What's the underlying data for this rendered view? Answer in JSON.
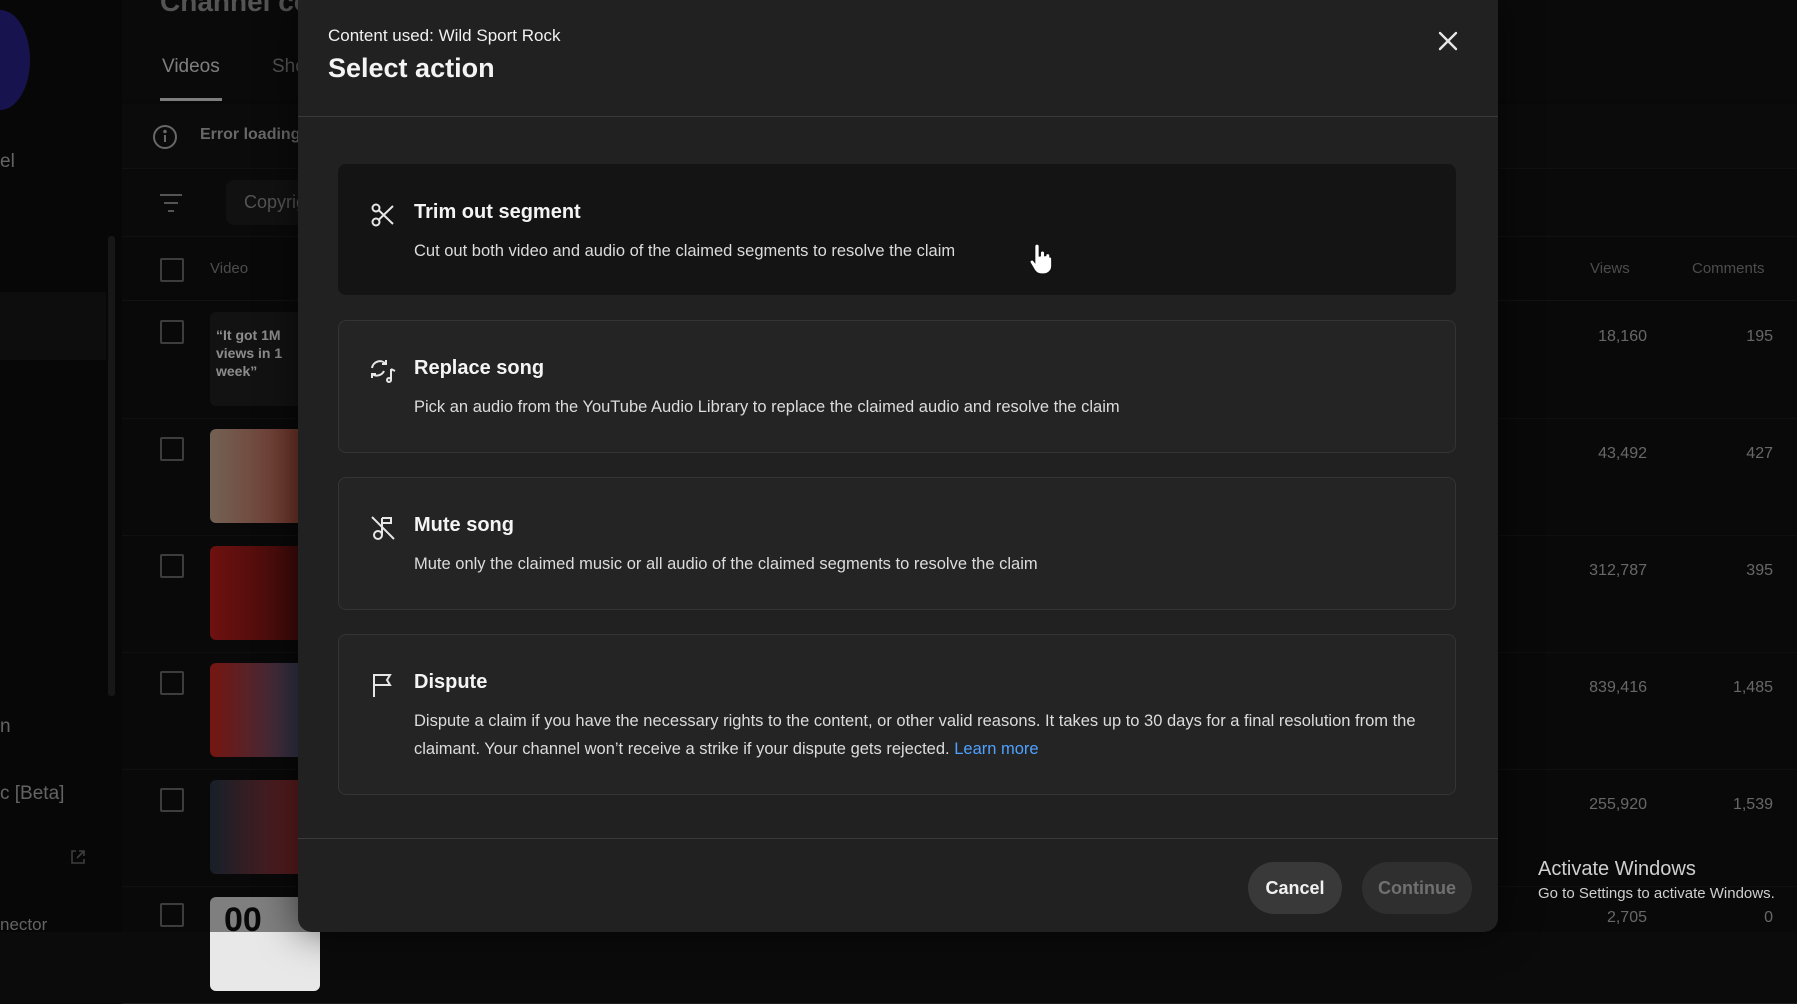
{
  "background": {
    "rail": {
      "texts": [
        "el",
        "n",
        "c [Beta]",
        "nector"
      ]
    },
    "tabs": [
      "Videos",
      "Sho"
    ],
    "header_partial": "Channel co",
    "error_text": "Error loading",
    "filter_chip": "Copyrig",
    "columns": {
      "video": "Video",
      "views": "Views",
      "comments": "Comments"
    },
    "rows": [
      {
        "thumb_text": "“It got 1M views in 1 week”",
        "views": "18,160",
        "comments": "195"
      },
      {
        "thumb_text": "",
        "views": "43,492",
        "comments": "427"
      },
      {
        "thumb_text": "",
        "views": "312,787",
        "comments": "395"
      },
      {
        "thumb_text": "",
        "views": "839,416",
        "comments": "1,485"
      },
      {
        "thumb_text": "",
        "views": "255,920",
        "comments": "1,539"
      },
      {
        "thumb_text": "00",
        "views": "2,705",
        "comments": "0"
      }
    ]
  },
  "dialog": {
    "subtitle": "Content used: Wild Sport Rock",
    "title": "Select action",
    "options": [
      {
        "icon": "scissors-icon",
        "title": "Trim out segment",
        "desc": "Cut out both video and audio of the claimed segments to resolve the claim",
        "selected": true
      },
      {
        "icon": "replace-song-icon",
        "title": "Replace song",
        "desc": "Pick an audio from the YouTube Audio Library to replace the claimed audio and resolve the claim",
        "selected": false
      },
      {
        "icon": "mute-music-icon",
        "title": "Mute song",
        "desc": "Mute only the claimed music or all audio of the claimed segments to resolve the claim",
        "selected": false
      },
      {
        "icon": "flag-icon",
        "title": "Dispute",
        "desc": "Dispute a claim if you have the necessary rights to the content, or other valid reasons. It takes up to 30 days for a final resolution from the claimant. Your channel won’t receive a strike if your dispute gets rejected.",
        "link": "Learn more",
        "selected": false
      }
    ],
    "cancel_label": "Cancel",
    "continue_label": "Continue"
  },
  "windows_watermark": {
    "line1": "Activate Windows",
    "line2": "Go to Settings to activate Windows."
  }
}
